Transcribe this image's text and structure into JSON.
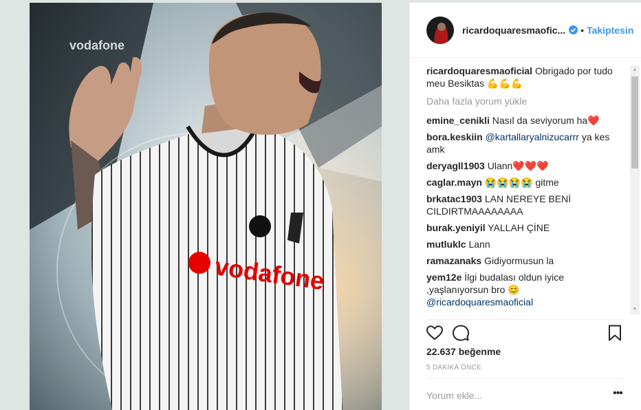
{
  "post": {
    "author": "ricardoquaresmaoficial",
    "author_truncated": "ricardoquaresmaofic...",
    "follow_label": "Takiptesin",
    "separator": "•",
    "photo_text": "vodafone"
  },
  "caption": {
    "user": "ricardoquaresmaoficial",
    "text": "Obrigado por tudo meu Besiktas 💪💪💪"
  },
  "load_more": "Daha fazla yorum yükle",
  "comments": [
    {
      "user": "emine_cenikli",
      "text": "Nasıl da seviyorum ha❤️",
      "mention": ""
    },
    {
      "user": "bora.keskiin",
      "mention": "@kartallaryalnizucarrr",
      "text": "ya kes amk"
    },
    {
      "user": "deryagll1903",
      "text": "Ulann❤️❤️❤️",
      "mention": ""
    },
    {
      "user": "caglar.mayn",
      "text": "😭😭😭😭 gitme",
      "mention": ""
    },
    {
      "user": "brkatac1903",
      "text": "LAN NEREYE BENİ CILDIRTMAAAAAAAA",
      "mention": ""
    },
    {
      "user": "burak.yeniyil",
      "text": "YALLAH ÇİNE",
      "mention": ""
    },
    {
      "user": "mutluklc",
      "text": "Lann",
      "mention": ""
    },
    {
      "user": "ramazanaks",
      "text": "Gidiyormusun la",
      "mention": ""
    },
    {
      "user": "yem12e",
      "text": "İlgi budalası oldun iyice ,yaşlanıyorsun bro 😊",
      "mention": "@ricardoquaresmaoficial"
    }
  ],
  "likes_text": "22.637 beğenme",
  "timestamp": "5 DAKİKA ÖNCE",
  "comment_box": {
    "placeholder": "Yorum ekle..."
  },
  "icons": {
    "like": "heart-icon",
    "comment": "comment-bubble-icon",
    "save": "bookmark-icon",
    "more": "more-options-icon",
    "verified": "verified-badge-icon"
  },
  "colors": {
    "link_blue": "#3897f0",
    "mention_blue": "#003569",
    "text": "#262626",
    "muted": "#999999",
    "background": "#dfe5e3"
  }
}
